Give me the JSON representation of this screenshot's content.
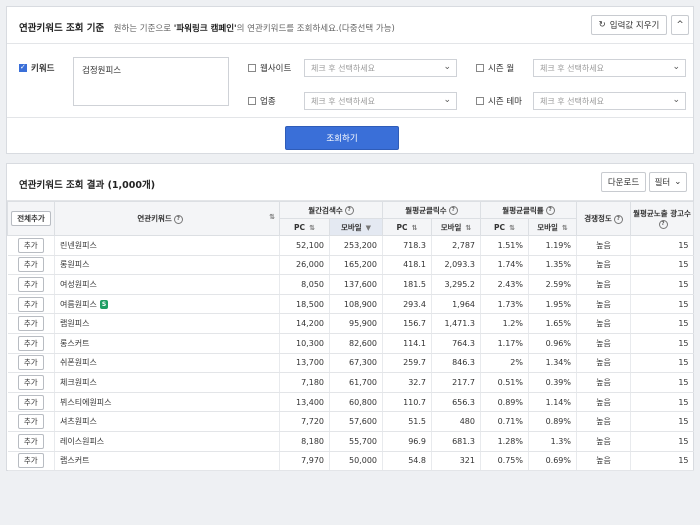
{
  "criteria": {
    "title": "연관키워드 조회 기준",
    "hint_prefix": "원하는 기준으로",
    "hint_bold": "'파워링크 캠페인'",
    "hint_suffix": "의 연관키워드를 조회하세요.(다중선택 가능)",
    "reset_label": "입력값 지우기",
    "collapse_label": "^",
    "keyword_label": "키워드",
    "keyword_value": "검정원피스",
    "website_label": "웹사이트",
    "industry_label": "업종",
    "season_month_label": "시즌 월",
    "season_theme_label": "시즌 테마",
    "select_placeholder": "체크 후 선택하세요",
    "search_button": "조회하기"
  },
  "results": {
    "title": "연관키워드 조회 결과 (1,000개)",
    "download_label": "다운로드",
    "filter_label": "필터",
    "add_all_label": "전체추가",
    "col_keyword": "연관키워드",
    "col_monthly_search": "월간검색수",
    "col_monthly_clicks": "월평균클릭수",
    "col_monthly_ctr": "월평균클릭률",
    "col_competition": "경쟁정도",
    "col_ad_count": "월평균노출 광고수",
    "pc_label": "PC",
    "mobile_label": "모바일",
    "add_label": "추가",
    "badge_label": "S",
    "rows": [
      {
        "kw": "린넨원피스",
        "pc": "52,100",
        "mo": "253,200",
        "cpc": "718.3",
        "cmo": "2,787",
        "rpc": "1.51%",
        "rmo": "1.19%",
        "comp": "높음",
        "ads": "15"
      },
      {
        "kw": "롱원피스",
        "pc": "26,000",
        "mo": "165,200",
        "cpc": "418.1",
        "cmo": "2,093.3",
        "rpc": "1.74%",
        "rmo": "1.35%",
        "comp": "높음",
        "ads": "15"
      },
      {
        "kw": "여성원피스",
        "pc": "8,050",
        "mo": "137,600",
        "cpc": "181.5",
        "cmo": "3,295.2",
        "rpc": "2.43%",
        "rmo": "2.59%",
        "comp": "높음",
        "ads": "15"
      },
      {
        "kw": "여름원피스",
        "pc": "18,500",
        "mo": "108,900",
        "cpc": "293.4",
        "cmo": "1,964",
        "rpc": "1.73%",
        "rmo": "1.95%",
        "comp": "높음",
        "ads": "15",
        "badge": true
      },
      {
        "kw": "랩원피스",
        "pc": "14,200",
        "mo": "95,900",
        "cpc": "156.7",
        "cmo": "1,471.3",
        "rpc": "1.2%",
        "rmo": "1.65%",
        "comp": "높음",
        "ads": "15"
      },
      {
        "kw": "롱스커트",
        "pc": "10,300",
        "mo": "82,600",
        "cpc": "114.1",
        "cmo": "764.3",
        "rpc": "1.17%",
        "rmo": "0.96%",
        "comp": "높음",
        "ads": "15"
      },
      {
        "kw": "쉬폰원피스",
        "pc": "13,700",
        "mo": "67,300",
        "cpc": "259.7",
        "cmo": "846.3",
        "rpc": "2%",
        "rmo": "1.34%",
        "comp": "높음",
        "ads": "15"
      },
      {
        "kw": "체크원피스",
        "pc": "7,180",
        "mo": "61,700",
        "cpc": "32.7",
        "cmo": "217.7",
        "rpc": "0.51%",
        "rmo": "0.39%",
        "comp": "높음",
        "ads": "15"
      },
      {
        "kw": "뷔스티에원피스",
        "pc": "13,400",
        "mo": "60,800",
        "cpc": "110.7",
        "cmo": "656.3",
        "rpc": "0.89%",
        "rmo": "1.14%",
        "comp": "높음",
        "ads": "15"
      },
      {
        "kw": "셔츠원피스",
        "pc": "7,720",
        "mo": "57,600",
        "cpc": "51.5",
        "cmo": "480",
        "rpc": "0.71%",
        "rmo": "0.89%",
        "comp": "높음",
        "ads": "15"
      },
      {
        "kw": "레이스원피스",
        "pc": "8,180",
        "mo": "55,700",
        "cpc": "96.9",
        "cmo": "681.3",
        "rpc": "1.28%",
        "rmo": "1.3%",
        "comp": "높음",
        "ads": "15"
      },
      {
        "kw": "랩스커트",
        "pc": "7,970",
        "mo": "50,000",
        "cpc": "54.8",
        "cmo": "321",
        "rpc": "0.75%",
        "rmo": "0.69%",
        "comp": "높음",
        "ads": "15"
      }
    ]
  }
}
